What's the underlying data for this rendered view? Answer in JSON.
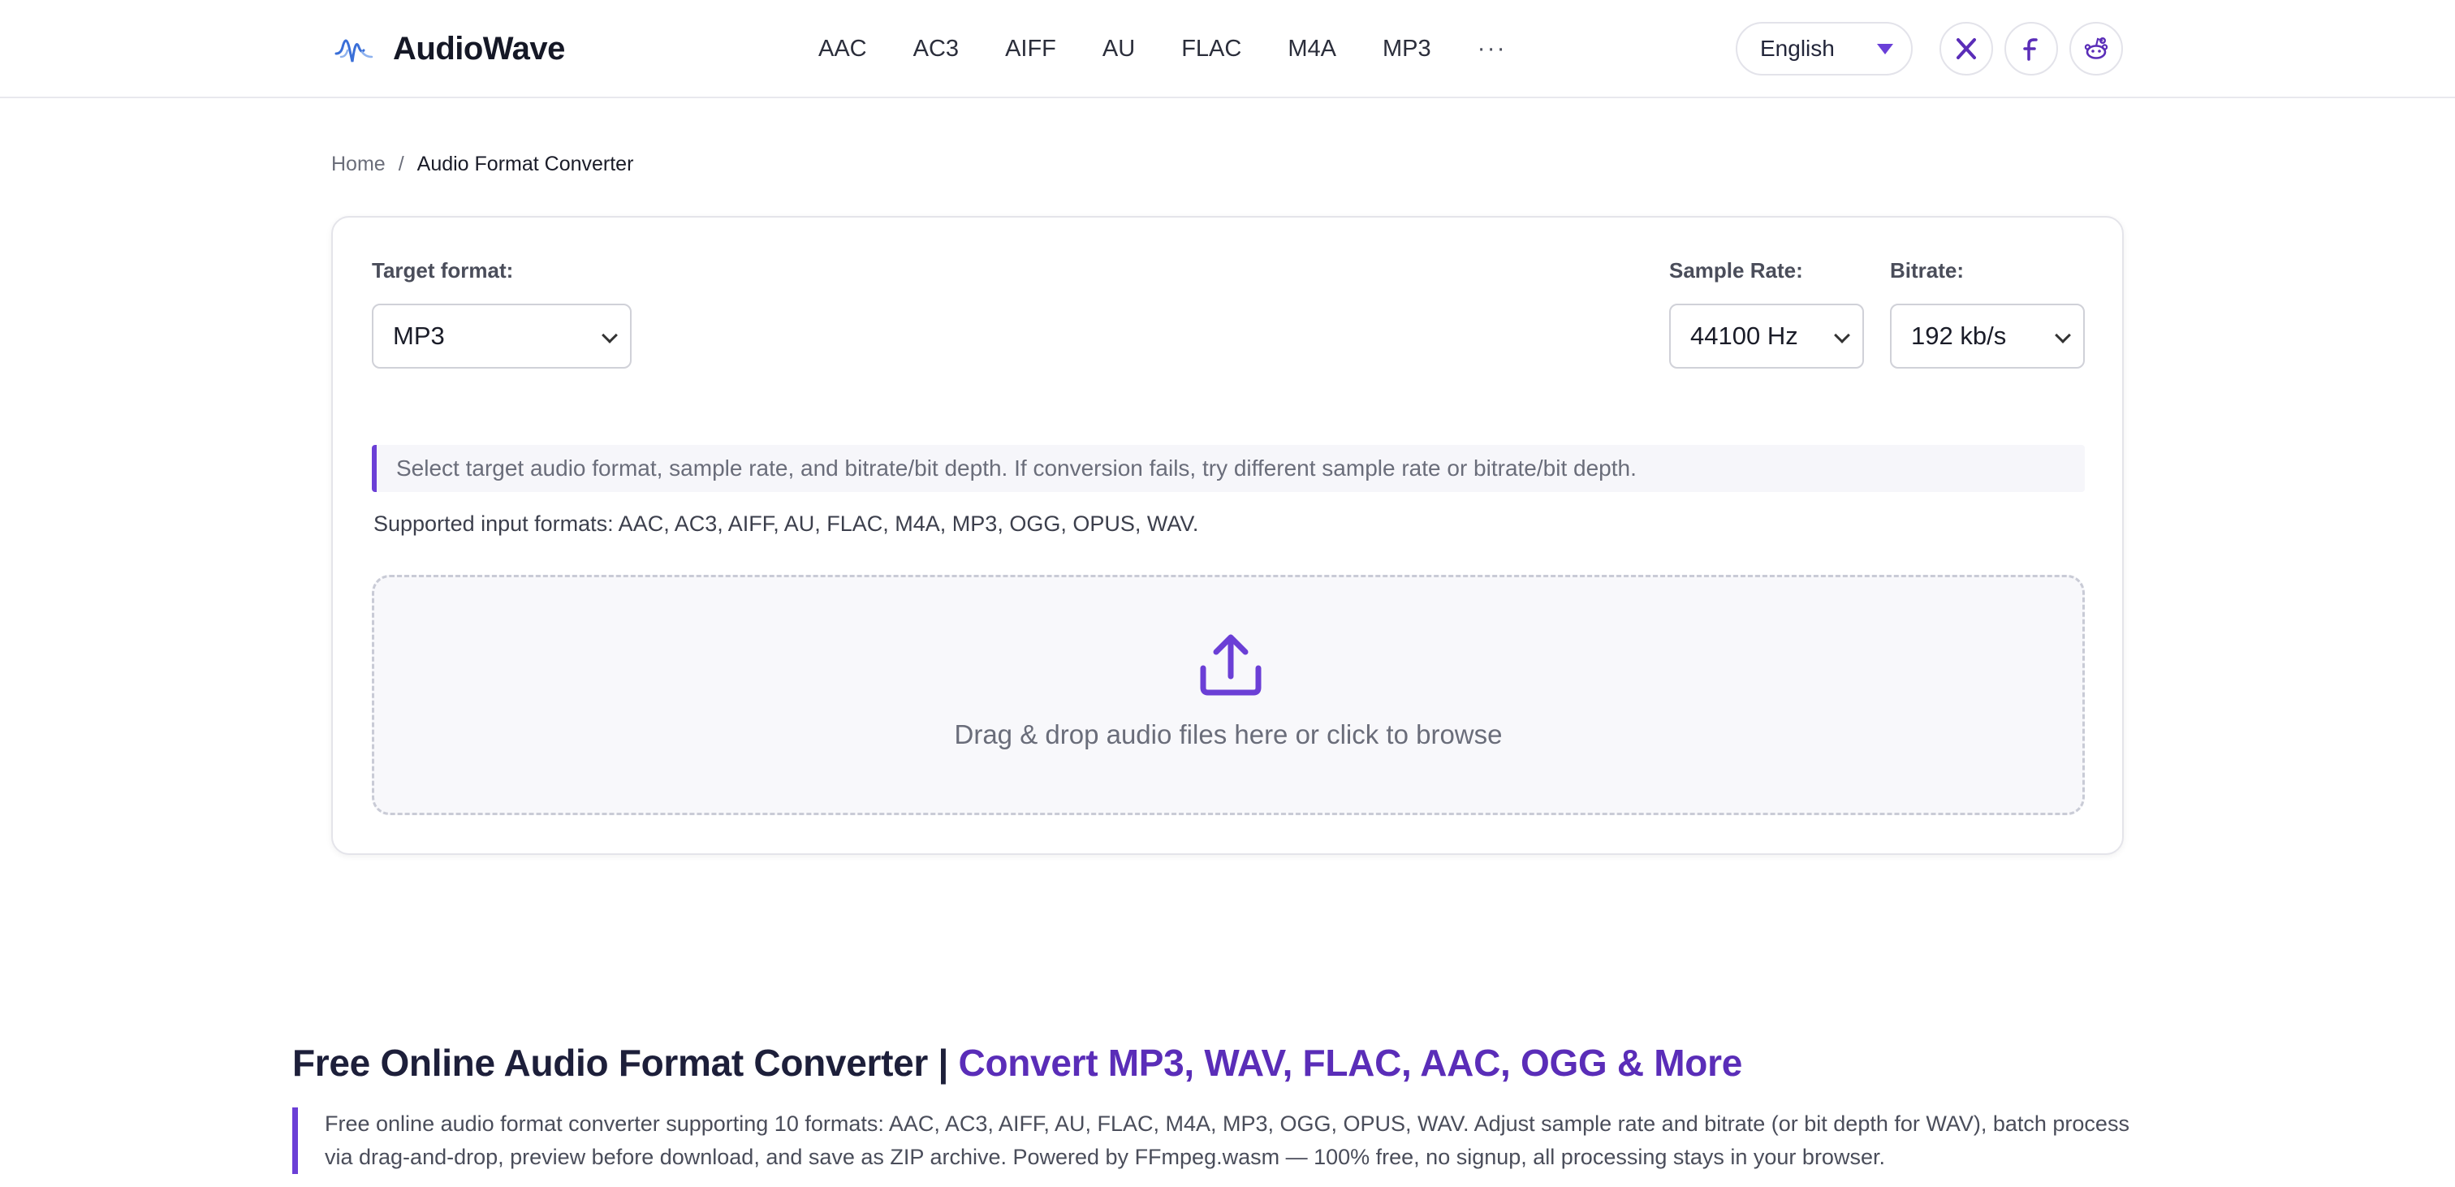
{
  "brand": {
    "name": "AudioWave"
  },
  "nav": {
    "items": [
      "AAC",
      "AC3",
      "AIFF",
      "AU",
      "FLAC",
      "M4A",
      "MP3"
    ],
    "more": "···"
  },
  "language": {
    "selected": "English"
  },
  "social": {
    "x": "x-icon",
    "facebook": "facebook-icon",
    "reddit": "reddit-icon"
  },
  "breadcrumb": {
    "home": "Home",
    "separator": "/",
    "current": "Audio Format Converter"
  },
  "converter": {
    "target_format_label": "Target format:",
    "target_format_value": "MP3",
    "sample_rate_label": "Sample Rate:",
    "sample_rate_value": "44100 Hz",
    "bitrate_label": "Bitrate:",
    "bitrate_value": "192 kb/s",
    "info": "Select target audio format, sample rate, and bitrate/bit depth. If conversion fails, try different sample rate or bitrate/bit depth.",
    "supported": "Supported input formats: AAC, AC3, AIFF, AU, FLAC, M4A, MP3, OGG, OPUS, WAV.",
    "dropzone_text": "Drag & drop audio files here or click to browse"
  },
  "article": {
    "title_part1": "Free Online Audio Format Converter | ",
    "title_part2": "Convert MP3, WAV, FLAC, AAC, OGG & More",
    "description": "Free online audio format converter supporting 10 formats: AAC, AC3, AIFF, AU, FLAC, M4A, MP3, OGG, OPUS, WAV. Adjust sample rate and bitrate (or bit depth for WAV), batch process via drag-and-drop, preview before download, and save as ZIP archive. Powered by FFmpeg.wasm — 100% free, no signup, all processing stays in your browser."
  },
  "colors": {
    "accent": "#6b3fd6",
    "headline_purple": "#5a2db8",
    "text_dark": "#1d1f3a"
  }
}
